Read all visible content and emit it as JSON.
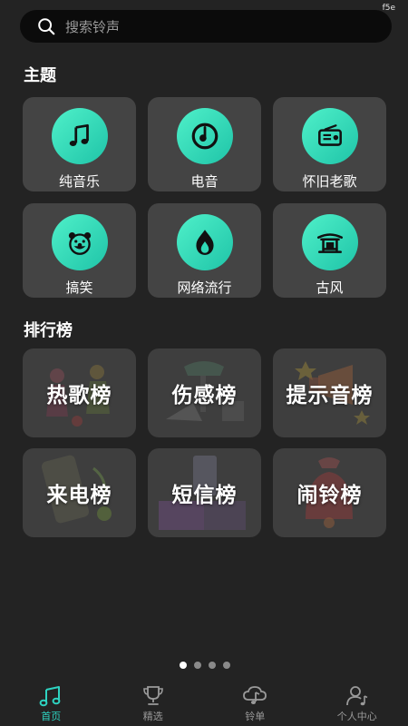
{
  "status": {
    "tag": "f5e"
  },
  "search": {
    "placeholder": "搜索铃声",
    "icon": "search-icon"
  },
  "themes": {
    "title": "主题",
    "items": [
      {
        "label": "纯音乐",
        "icon": "music-note-icon"
      },
      {
        "label": "电音",
        "icon": "vinyl-disc-icon"
      },
      {
        "label": "怀旧老歌",
        "icon": "radio-icon"
      },
      {
        "label": "搞笑",
        "icon": "clown-face-icon"
      },
      {
        "label": "网络流行",
        "icon": "flame-icon"
      },
      {
        "label": "古风",
        "icon": "pavilion-icon"
      }
    ]
  },
  "rankings": {
    "title": "排行榜",
    "items": [
      {
        "label": "热歌榜"
      },
      {
        "label": "伤感榜"
      },
      {
        "label": "提示音榜"
      },
      {
        "label": "来电榜"
      },
      {
        "label": "短信榜"
      },
      {
        "label": "闹铃榜"
      }
    ]
  },
  "pager": {
    "count": 4,
    "active": 0
  },
  "tabbar": {
    "items": [
      {
        "label": "首页",
        "icon": "music-notes-icon",
        "active": true
      },
      {
        "label": "精选",
        "icon": "trophy-icon",
        "active": false
      },
      {
        "label": "铃单",
        "icon": "cloud-music-icon",
        "active": false
      },
      {
        "label": "个人中心",
        "icon": "user-music-icon",
        "active": false
      }
    ]
  },
  "colors": {
    "accent": "#2ed3c1",
    "background": "#232323",
    "card": "#444444"
  }
}
